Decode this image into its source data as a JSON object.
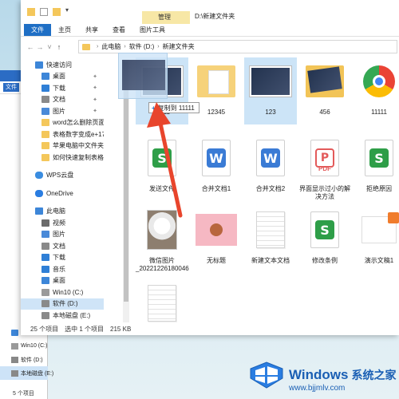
{
  "window": {
    "title_path": "D:\\新建文件夹",
    "contextual_tab": "管理",
    "ribbon_tabs": [
      "文件",
      "主页",
      "共享",
      "查看",
      "图片工具"
    ]
  },
  "address": {
    "crumbs": [
      "此电脑",
      "软件 (D:)",
      "新建文件夹"
    ]
  },
  "navpane": {
    "items": [
      {
        "label": "快速访问",
        "icon": "star-icon",
        "level": 1
      },
      {
        "label": "桌面",
        "icon": "desktop-folder-icon",
        "level": 2,
        "pinned": true
      },
      {
        "label": "下载",
        "icon": "download-icon",
        "level": 2,
        "pinned": true
      },
      {
        "label": "文档",
        "icon": "document-folder-icon",
        "level": 2,
        "pinned": true
      },
      {
        "label": "图片",
        "icon": "pictures-folder-icon",
        "level": 2,
        "pinned": true
      },
      {
        "label": "word怎么删除页面",
        "icon": "folder-icon",
        "level": 2
      },
      {
        "label": "表格数字变成e+17怎",
        "icon": "folder-icon",
        "level": 2
      },
      {
        "label": "苹果电脑中文件夹",
        "icon": "folder-icon",
        "level": 2
      },
      {
        "label": "如何快速复制表格",
        "icon": "folder-icon",
        "level": 2
      },
      {
        "label": "",
        "icon": "",
        "level": 0
      },
      {
        "label": "WPS云盘",
        "icon": "cloud-icon",
        "level": 1
      },
      {
        "label": "",
        "icon": "",
        "level": 0
      },
      {
        "label": "OneDrive",
        "icon": "onedrive-icon",
        "level": 1
      },
      {
        "label": "",
        "icon": "",
        "level": 0
      },
      {
        "label": "此电脑",
        "icon": "computer-icon",
        "level": 1
      },
      {
        "label": "视频",
        "icon": "video-folder-icon",
        "level": 2
      },
      {
        "label": "图片",
        "icon": "pictures-folder-icon",
        "level": 2
      },
      {
        "label": "文档",
        "icon": "document-folder-icon",
        "level": 2
      },
      {
        "label": "下载",
        "icon": "download-icon",
        "level": 2
      },
      {
        "label": "音乐",
        "icon": "music-icon",
        "level": 2
      },
      {
        "label": "桌面",
        "icon": "desktop-folder-icon",
        "level": 2
      },
      {
        "label": "Win10 (C:)",
        "icon": "drive-c-icon",
        "level": 2
      },
      {
        "label": "软件 (D:)",
        "icon": "drive-icon",
        "level": 2,
        "selected": true
      },
      {
        "label": "本地磁盘 (E:)",
        "icon": "drive-icon",
        "level": 2
      }
    ]
  },
  "status": {
    "count": "25 个项目",
    "selected": "选中 1 个项目",
    "size": "215 KB"
  },
  "files": [
    {
      "name": "11111",
      "type": "photo",
      "selected": true
    },
    {
      "name": "12345",
      "type": "pdf-folder"
    },
    {
      "name": "123",
      "type": "photo",
      "selected": true
    },
    {
      "name": "456",
      "type": "photo-folder"
    },
    {
      "name": "11111",
      "type": "chrome"
    },
    {
      "name": "",
      "type": "video"
    },
    {
      "name": "发送文件",
      "type": "wps-sheet"
    },
    {
      "name": "合并文档1",
      "type": "wps-writer"
    },
    {
      "name": "合并文档2",
      "type": "wps-writer"
    },
    {
      "name": "界面显示过小的解决方法",
      "type": "pdf"
    },
    {
      "name": "拒绝原因",
      "type": "wps-sheet"
    },
    {
      "name": "",
      "type": "partial-blue"
    },
    {
      "name": "微信图片_20221226180046",
      "type": "cat-photo"
    },
    {
      "name": "无标题",
      "type": "pink-image"
    },
    {
      "name": "新建文本文档",
      "type": "text"
    },
    {
      "name": "修改条例",
      "type": "wps-sheet"
    },
    {
      "name": "演示文稿1",
      "type": "ppt"
    },
    {
      "name": "",
      "type": "partial-photo"
    },
    {
      "name": "",
      "type": "text"
    }
  ],
  "drag": {
    "tooltip": "复制到 11111"
  },
  "bg_window": {
    "ribbon_tab": "文件",
    "nav": [
      "桌面",
      "Win10 (C:)",
      "软件 (D:)",
      "本地磁盘 (E:)"
    ],
    "status": "5 个项目"
  },
  "watermark": {
    "brand": "Windows",
    "sub": "系统之家",
    "url": "www.bjjmlv.com"
  },
  "colors": {
    "accent": "#1f6fc5",
    "selection": "#cce4f7",
    "context_tab": "#f7e7a6",
    "arrow": "#e8452c"
  }
}
